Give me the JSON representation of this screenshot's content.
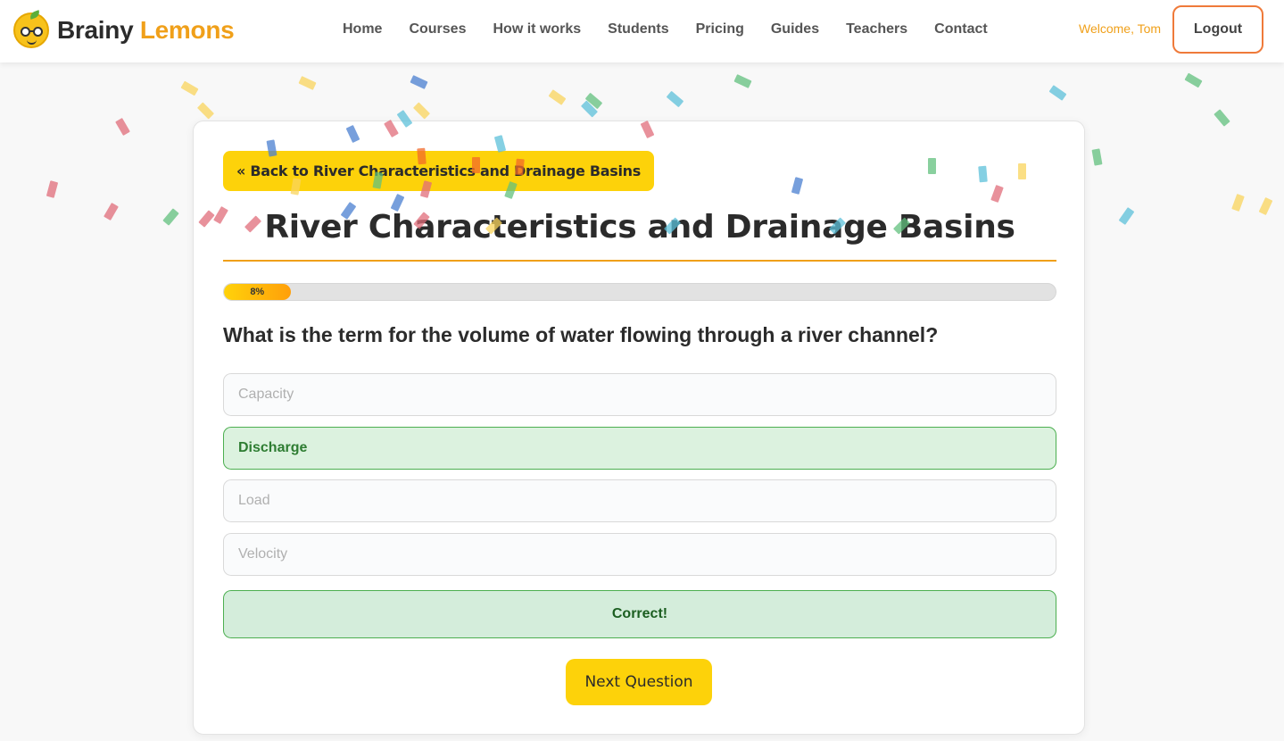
{
  "header": {
    "logo_word1": "Brainy",
    "logo_word2": "Lemons",
    "nav": [
      "Home",
      "Courses",
      "How it works",
      "Students",
      "Pricing",
      "Guides",
      "Teachers",
      "Contact"
    ],
    "welcome": "Welcome, Tom",
    "logout_label": "Logout"
  },
  "quiz": {
    "back_label": "« Back to River Characteristics and Drainage Basins",
    "title": "River Characteristics and Drainage Basins",
    "progress_percent": 8,
    "progress_label": "8%",
    "question": "What is the term for the volume of water flowing through a river channel?",
    "options": [
      "Capacity",
      "Discharge",
      "Load",
      "Velocity"
    ],
    "correct_option_index": 1,
    "feedback": "Correct!",
    "next_label": "Next Question"
  },
  "colors": {
    "brand_yellow": "#fdd20a",
    "brand_orange": "#f0a01a",
    "correct_green": "#4caf50",
    "logout_border": "#ef7a3a"
  },
  "icons": [
    "lemon-logo-icon"
  ]
}
